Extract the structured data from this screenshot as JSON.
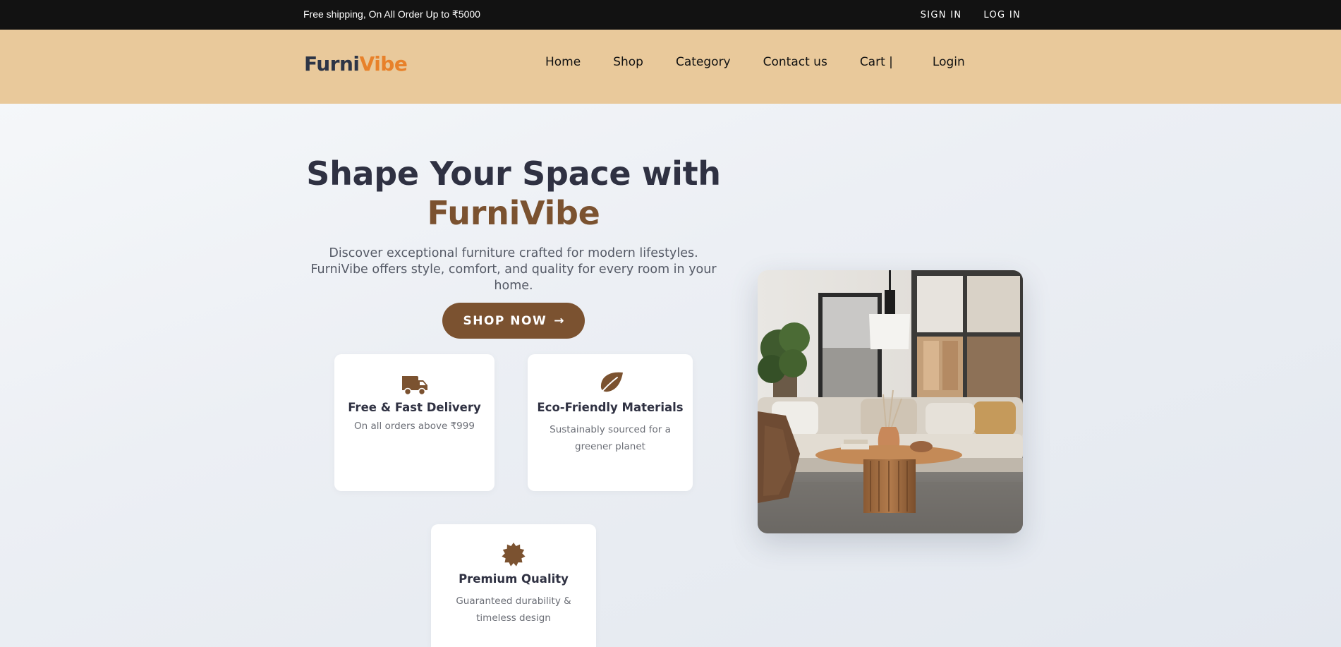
{
  "topbar": {
    "shipping_text": "Free shipping, On All Order Up to ₹5000",
    "sign_in": "SIGN IN",
    "log_in": "LOG IN"
  },
  "brand": {
    "part1": "Furni",
    "part2": "Vibe"
  },
  "nav": {
    "home": "Home",
    "shop": "Shop",
    "category": "Category",
    "contact": "Contact us",
    "cart": "Cart |",
    "login": "Login"
  },
  "hero": {
    "title": "Shape Your Space with",
    "title_brand": "FurniVibe",
    "description": "Discover exceptional furniture crafted for modern lifestyles. FurniVibe offers style, comfort, and quality for every room in your home.",
    "cta_label": "SHOP NOW",
    "cta_arrow": "→"
  },
  "features": [
    {
      "icon": "truck-icon",
      "title": "Free & Fast Delivery",
      "text": "On all orders above ₹999"
    },
    {
      "icon": "leaf-icon",
      "title": "Eco-Friendly Materials",
      "text": "Sustainably sourced for a greener planet"
    },
    {
      "icon": "badge-icon",
      "title": "Premium Quality",
      "text": "Guaranteed durability & timeless design"
    }
  ],
  "colors": {
    "topbar_bg": "#121212",
    "navbar_bg": "#e9c99b",
    "accent_brown": "#7b5230",
    "logo_orange": "#e8812a",
    "logo_dark": "#2d3546"
  }
}
